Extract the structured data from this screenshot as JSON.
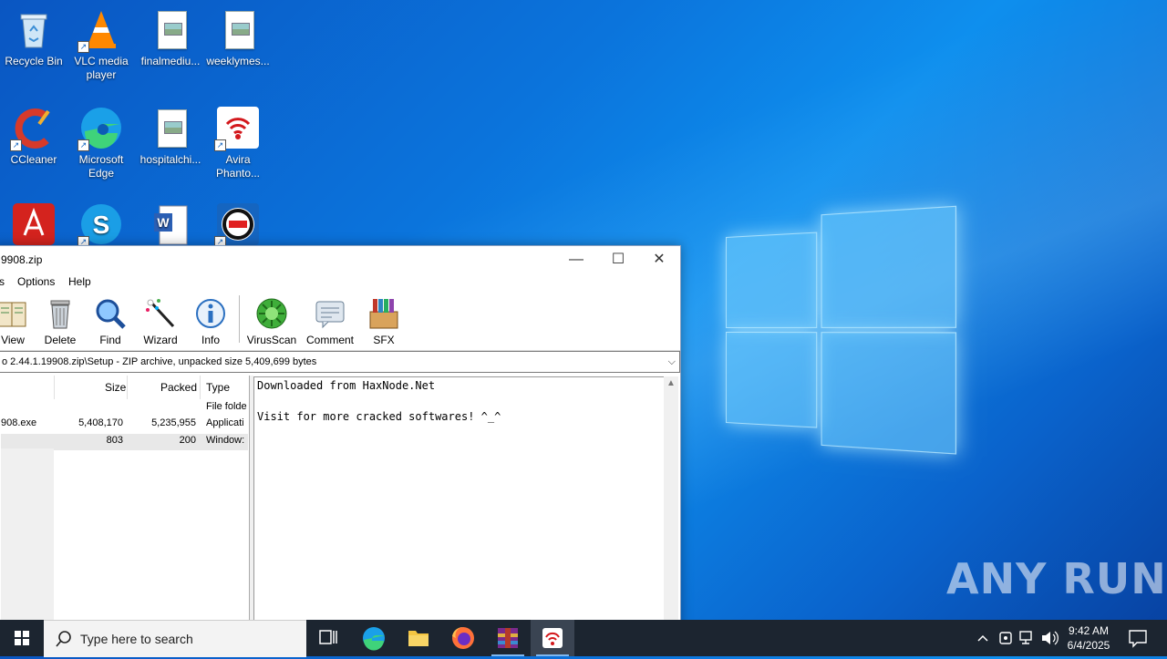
{
  "desktop": {
    "icons": [
      {
        "label": "Recycle Bin"
      },
      {
        "label": "VLC media player"
      },
      {
        "label": "finalmediu..."
      },
      {
        "label": "weeklymes..."
      },
      {
        "label": "CCleaner"
      },
      {
        "label": "Microsoft Edge"
      },
      {
        "label": "hospitalchi..."
      },
      {
        "label": "Avira Phanto..."
      },
      {
        "label": "Acrobat"
      },
      {
        "label": "Skype"
      },
      {
        "label": "Word"
      },
      {
        "label": "Data Reset"
      }
    ],
    "watermark": "ANY RUN"
  },
  "window": {
    "title": "9908.zip",
    "menu": [
      "s",
      "Options",
      "Help"
    ],
    "toolbar": [
      {
        "label": "View",
        "icon": "view-icon"
      },
      {
        "label": "Delete",
        "icon": "delete-icon"
      },
      {
        "label": "Find",
        "icon": "find-icon"
      },
      {
        "label": "Wizard",
        "icon": "wizard-icon"
      },
      {
        "label": "Info",
        "icon": "info-icon"
      },
      {
        "label": "VirusScan",
        "icon": "virusscan-icon"
      },
      {
        "label": "Comment",
        "icon": "comment-icon"
      },
      {
        "label": "SFX",
        "icon": "sfx-icon"
      }
    ],
    "path": "o 2.44.1.19908.zip\\Setup - ZIP archive, unpacked size 5,409,699 bytes",
    "columns": {
      "size": "Size",
      "packed": "Packed",
      "type": "Type"
    },
    "rows": [
      {
        "name": "",
        "size": "",
        "packed": "",
        "type": "File folde"
      },
      {
        "name": "908.exe",
        "size": "5,408,170",
        "packed": "5,235,955",
        "type": "Applicati"
      },
      {
        "name": "",
        "size": "803",
        "packed": "200",
        "type": "Window:"
      }
    ],
    "comment": {
      "line1": "Downloaded from HaxNode.Net",
      "line2": "Visit for more cracked softwares! ^_^"
    }
  },
  "taskbar": {
    "search_placeholder": "Type here to search",
    "time": "9:42 AM",
    "date": "6/4/2025"
  }
}
